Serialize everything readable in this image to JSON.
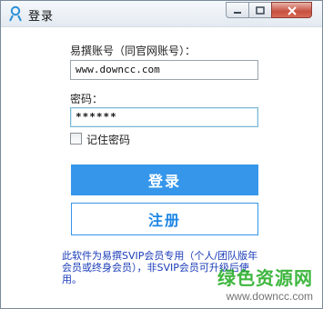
{
  "window": {
    "title": "登录",
    "icons": {
      "app": "user-icon",
      "minimize": "minimize-icon",
      "maximize": "maximize-icon",
      "close": "close-icon"
    }
  },
  "form": {
    "account_label": "易撰账号（同官网账号）：",
    "account_value": "www.downcc.com",
    "password_label": "密码：",
    "password_value": "******",
    "remember_label": "记住密码",
    "remember_checked": false
  },
  "buttons": {
    "login": "登录",
    "register": "注册"
  },
  "notice": "此软件为易撰SVIP会员专用（个人/团队版年会员或终身会员），非SVIP会员可升级后使用。",
  "watermark": {
    "brand": "绿色资源网",
    "url": "www.downcc.com"
  },
  "colors": {
    "primary": "#3596ea",
    "notice_text": "#1a3cb8",
    "watermark_green": "#1eaa1e",
    "close_red": "#c75040"
  }
}
